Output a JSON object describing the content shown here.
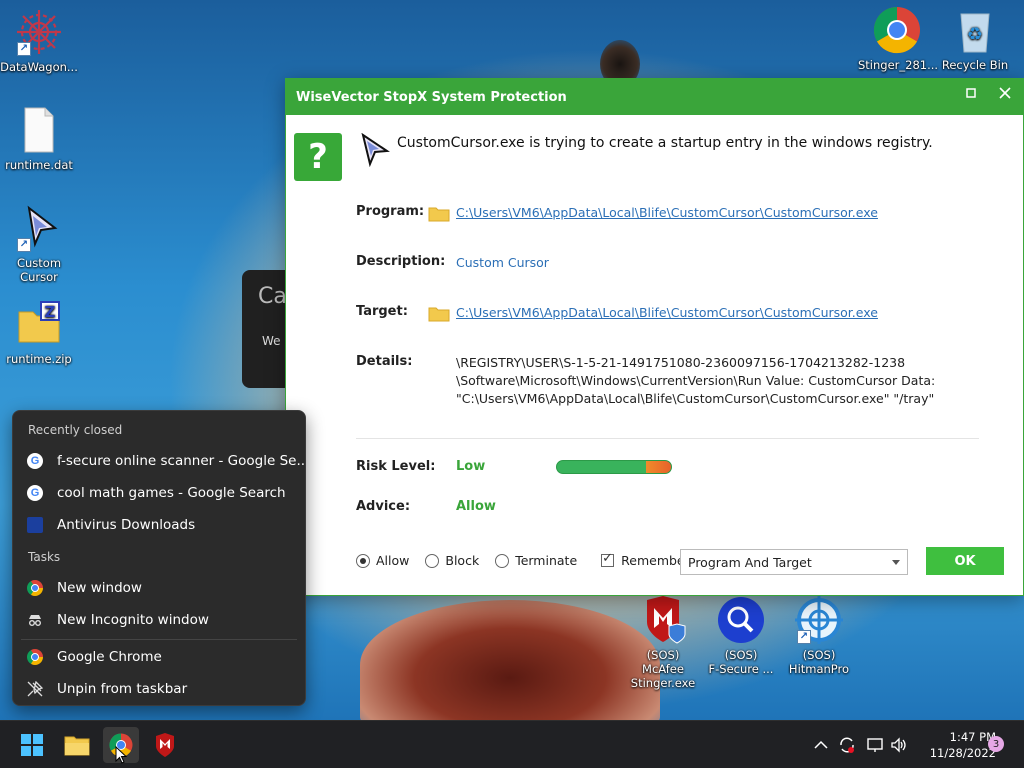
{
  "desktop": {
    "icons": {
      "datawagon": "DataWagon...",
      "runtime_dat": "runtime.dat",
      "custom_cursor": "Custom\nCursor",
      "runtime_zip": "runtime.zip",
      "stinger": "Stinger_281...",
      "recycle_bin": "Recycle Bin",
      "sos_mcafee": "(SOS) McAfee\nStinger.exe",
      "sos_fsecure": "(SOS)\nF-Secure ...",
      "sos_hitman": "(SOS)\nHitmanPro"
    },
    "bg_window": {
      "title_fragment": "Ca",
      "text_fragment": "We"
    }
  },
  "dialog": {
    "title": "WiseVector StopX System Protection",
    "headline": "CustomCursor.exe is trying to create a startup entry in the windows registry.",
    "program_label": "Program:",
    "program_value": "C:\\Users\\VM6\\AppData\\Local\\Blife\\CustomCursor\\CustomCursor.exe",
    "description_label": "Description:",
    "description_value": "Custom Cursor",
    "target_label": "Target:",
    "target_value": "C:\\Users\\VM6\\AppData\\Local\\Blife\\CustomCursor\\CustomCursor.exe",
    "details_label": "Details:",
    "details_lines": [
      "\\REGISTRY\\USER\\S-1-5-21-1491751080-2360097156-1704213282-1238",
      "\\Software\\Microsoft\\Windows\\CurrentVersion\\Run Value: CustomCursor Data:",
      "\"C:\\Users\\VM6\\AppData\\Local\\Blife\\CustomCursor\\CustomCursor.exe\" \"/tray\""
    ],
    "risk_label": "Risk Level:",
    "risk_value": "Low",
    "risk_fraction": 0.78,
    "advice_label": "Advice:",
    "advice_value": "Allow",
    "options": {
      "allow": "Allow",
      "block": "Block",
      "terminate": "Terminate",
      "remember": "Remember",
      "selected": "allow",
      "remember_checked": true
    },
    "scope_select": "Program And Target",
    "ok_label": "OK",
    "colors": {
      "accent": "#3aa53a",
      "link": "#2b6fb6"
    }
  },
  "jumplist": {
    "recently_closed_header": "Recently closed",
    "recent": [
      "f-secure online scanner - Google Se...",
      "cool math games - Google Search",
      "Antivirus Downloads"
    ],
    "tasks_header": "Tasks",
    "tasks": [
      "New window",
      "New Incognito window"
    ],
    "app_name": "Google Chrome",
    "unpin": "Unpin from taskbar"
  },
  "taskbar": {
    "time": "1:47 PM",
    "date": "11/28/2022",
    "notification_count": "3"
  }
}
